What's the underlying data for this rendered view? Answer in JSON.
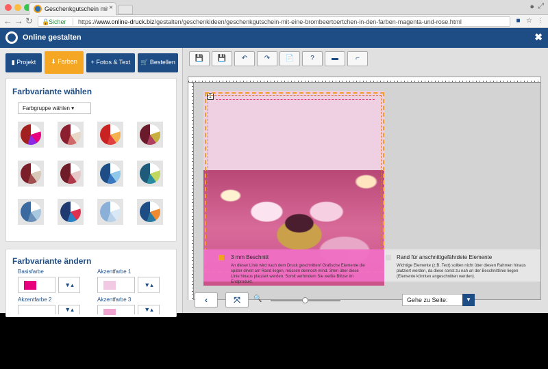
{
  "browser": {
    "tab_title": "Geschenkgutschein mit einem",
    "tab_close": "×",
    "secure_label": "Sicher",
    "url_prefix": "https://",
    "url_host": "www.online-druck.biz",
    "url_path": "/gestalten/geschenkideen/geschenkgutschein-mit-eine-brombeertoertchen-in-den-farben-magenta-und-rose.html"
  },
  "app": {
    "title": "Online gestalten",
    "close": "✖"
  },
  "left_tabs": [
    {
      "label": "Projekt",
      "icon": "bookmark-icon",
      "glyph": "▮"
    },
    {
      "label": "Farben",
      "icon": "paint-drop-icon",
      "glyph": "⬇"
    },
    {
      "label": "Fotos & Text",
      "icon": "plus-icon",
      "glyph": "+"
    },
    {
      "label": "Bestellen",
      "icon": "cart-icon",
      "glyph": "🛒"
    }
  ],
  "color_variant": {
    "heading": "Farbvariante wählen",
    "group_select": "Farbgruppe wählen ▾"
  },
  "color_change": {
    "heading": "Farbvariante ändern",
    "labels": [
      "Basisfarbe",
      "Akzentfarbe 1",
      "Akzentfarbe 2",
      "Akzentfarbe 3"
    ],
    "colors": [
      "#e6007e",
      "#f2c9e2",
      "#ffffff",
      "#f0a3cf"
    ]
  },
  "editor": {
    "page_number": "1",
    "legend_left_title": "3 mm Beschnitt",
    "legend_left_text": "An dieser Linie wird nach dem Druck geschnitten! Grafische Elemente die später direkt am Rand liegen, müssen dennoch mind. 3mm über diese Linie hinaus platziert werden. Somit verhindern Sie weiße Blitzer im Endprodukt.",
    "legend_right_title": "Rand für anschnittgefährdete Elemente",
    "legend_right_text": "Wichtige Elemente (z.B. Text) sollten nicht über diesen Rahmen hinaus platziert werden, da diese sonst zu nah an der Beschnittlinie liegen (Elemente könnten angeschnitten werden).",
    "goto_label": "Gehe zu Seite:"
  },
  "colors": {
    "brand": "#1e4d86",
    "accent": "#f5a623",
    "magenta": "#e6007e"
  }
}
